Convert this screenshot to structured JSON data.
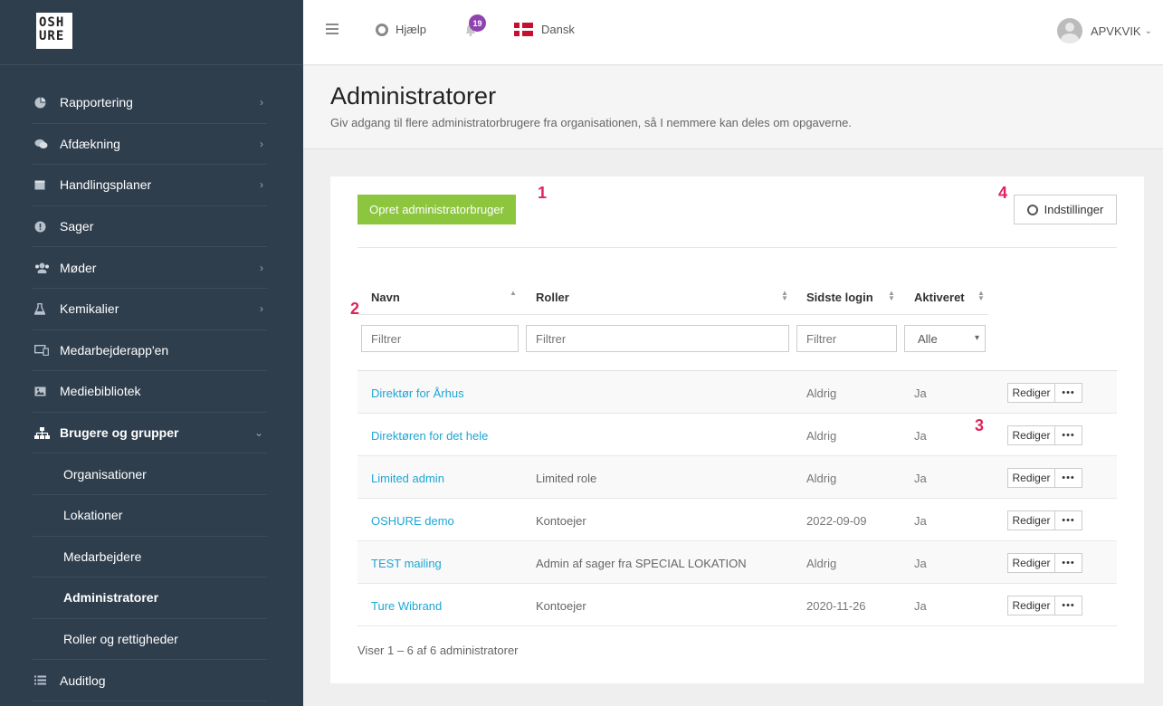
{
  "logo": {
    "line1": "OSH",
    "line2": "URE"
  },
  "sidebar": {
    "items": [
      {
        "label": "Rapportering",
        "icon": "pie-chart-icon",
        "chevron": "›"
      },
      {
        "label": "Afdækning",
        "icon": "chat-bubbles-icon",
        "chevron": "›"
      },
      {
        "label": "Handlingsplaner",
        "icon": "calendar-icon",
        "chevron": "›"
      },
      {
        "label": "Sager",
        "icon": "alert-circle-icon",
        "chevron": ""
      },
      {
        "label": "Møder",
        "icon": "people-icon",
        "chevron": "›"
      },
      {
        "label": "Kemikalier",
        "icon": "flask-icon",
        "chevron": "›"
      },
      {
        "label": "Medarbejderapp'en",
        "icon": "devices-icon",
        "chevron": ""
      },
      {
        "label": "Mediebibliotek",
        "icon": "image-icon",
        "chevron": ""
      },
      {
        "label": "Brugere og grupper",
        "icon": "sitemap-icon",
        "chevron": "⌄"
      }
    ],
    "subitems": [
      {
        "label": "Organisationer"
      },
      {
        "label": "Lokationer"
      },
      {
        "label": "Medarbejdere"
      },
      {
        "label": "Administratorer"
      },
      {
        "label": "Roller og rettigheder"
      }
    ],
    "last_item": {
      "label": "Auditlog",
      "icon": "list-icon"
    }
  },
  "topbar": {
    "help_label": "Hjælp",
    "notification_count": "19",
    "language_label": "Dansk",
    "user_label": "APVKVIK",
    "user_caret": "⌄"
  },
  "page": {
    "title": "Administratorer",
    "subtitle": "Giv adgang til flere administratorbrugere fra organisationen, så I nemmere kan deles om opgaverne."
  },
  "toolbar": {
    "create_label": "Opret administratorbruger",
    "settings_label": "Indstillinger"
  },
  "annotations": {
    "a1": "1",
    "a2": "2",
    "a3": "3",
    "a4": "4"
  },
  "table": {
    "columns": [
      {
        "label": "Navn"
      },
      {
        "label": "Roller"
      },
      {
        "label": "Sidste login"
      },
      {
        "label": "Aktiveret"
      }
    ],
    "filters": {
      "name_placeholder": "Filtrer",
      "role_placeholder": "Filtrer",
      "login_placeholder": "Filtrer",
      "activated_value": "Alle"
    },
    "rows": [
      {
        "name": "Direktør for Århus",
        "role": "",
        "login": "Aldrig",
        "activated": "Ja"
      },
      {
        "name": "Direktøren for det hele",
        "role": "",
        "login": "Aldrig",
        "activated": "Ja"
      },
      {
        "name": "Limited admin",
        "role": "Limited role",
        "login": "Aldrig",
        "activated": "Ja"
      },
      {
        "name": "OSHURE demo",
        "role": "Kontoejer",
        "login": "2022-09-09",
        "activated": "Ja"
      },
      {
        "name": "TEST mailing",
        "role": "Admin af sager fra SPECIAL LOKATION",
        "login": "Aldrig",
        "activated": "Ja"
      },
      {
        "name": "Ture Wibrand",
        "role": "Kontoejer",
        "login": "2020-11-26",
        "activated": "Ja"
      }
    ],
    "row_edit_label": "Rediger",
    "row_more_label": "•••"
  },
  "footer": {
    "summary": "Viser 1 – 6 af 6 administratorer"
  }
}
